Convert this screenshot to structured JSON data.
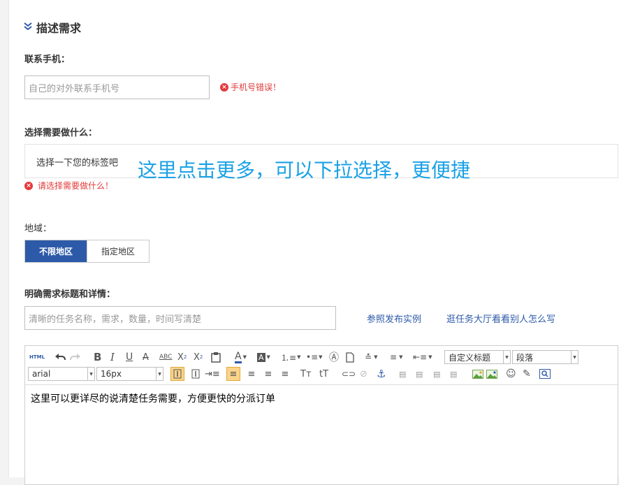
{
  "section": {
    "title": "描述需求",
    "icon": "chevron-double-down-icon"
  },
  "phone": {
    "label": "联系手机：",
    "placeholder": "自己的对外联系手机号",
    "error": "手机号错误！"
  },
  "task_type": {
    "label": "选择需要做什么：",
    "placeholder": "选择一下您的标签吧",
    "error": "请选择需要做什么！"
  },
  "hint_overlay": "这里点击更多，可以下拉选择，更便捷",
  "region": {
    "label": "地域：",
    "options": [
      "不限地区",
      "指定地区"
    ],
    "selected": "不限地区"
  },
  "detail": {
    "label": "明确需求标题和详情：",
    "title_placeholder": "清晰的任务名称，需求，数量，时间写清楚",
    "link_example": "参照发布实例",
    "link_hall": "逛任务大厅看看别人怎么写"
  },
  "editor": {
    "html_label": "HTML",
    "heading_select": "自定义标题",
    "paragraph_select": "段落",
    "font_family": "arial",
    "font_size": "16px",
    "content": "这里可以更详尽的说清楚任务需要，方便更快的分派订单"
  },
  "colors": {
    "accent": "#2d5aa8",
    "error": "#e4393c",
    "hint": "#1aa1e6"
  }
}
